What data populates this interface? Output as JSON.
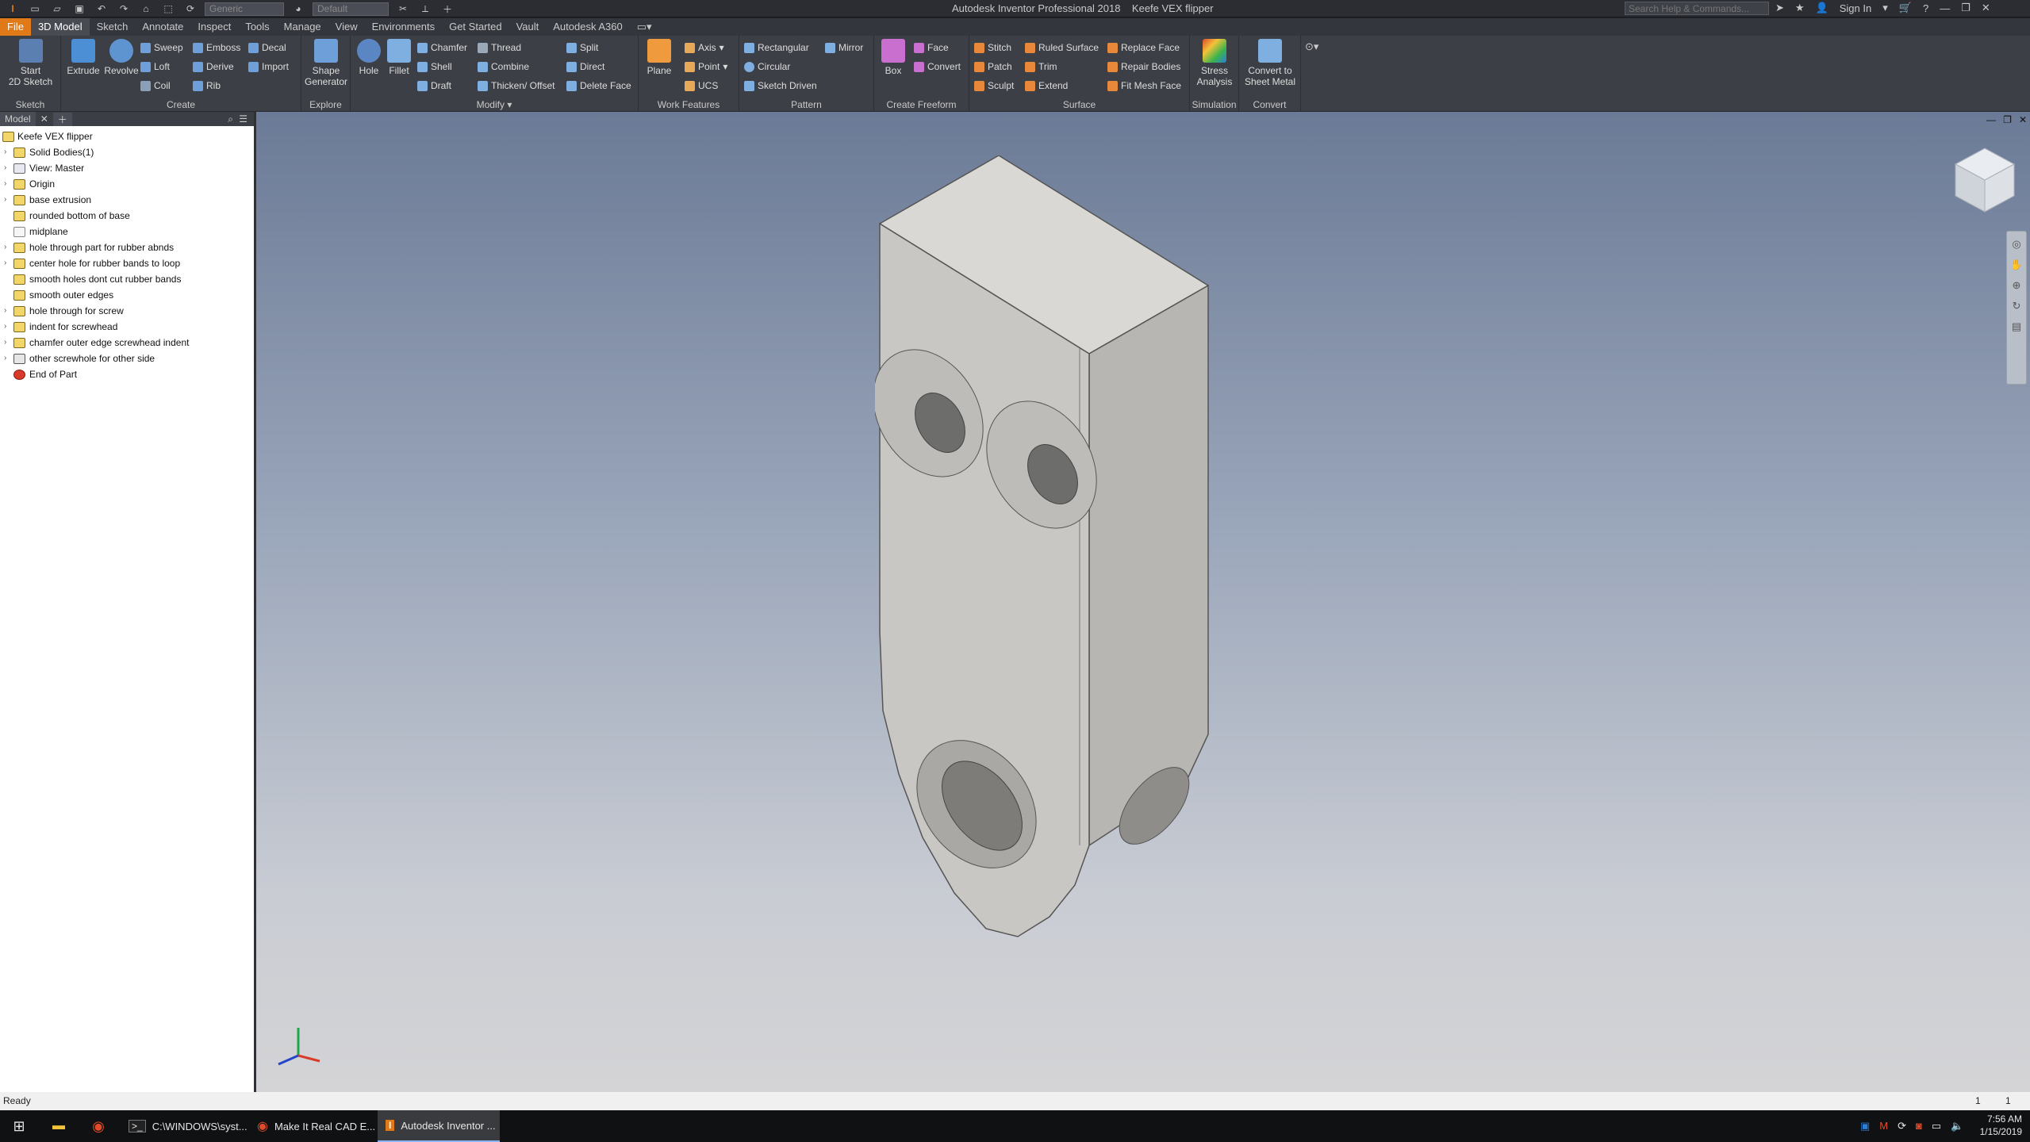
{
  "app": {
    "title": "Autodesk Inventor Professional 2018",
    "document": "Keefe VEX flipper"
  },
  "quick_access": {
    "material_combo": "Generic",
    "appearance_combo": "Default"
  },
  "search": {
    "placeholder": "Search Help & Commands..."
  },
  "account": {
    "sign_in": "Sign In"
  },
  "tabs": [
    "File",
    "3D Model",
    "Sketch",
    "Annotate",
    "Inspect",
    "Tools",
    "Manage",
    "View",
    "Environments",
    "Get Started",
    "Vault",
    "Autodesk A360"
  ],
  "ribbon": {
    "sketch": {
      "label": "Sketch",
      "start_sketch": "Start\n2D Sketch"
    },
    "create": {
      "label": "Create",
      "extrude": "Extrude",
      "revolve": "Revolve",
      "sweep": "Sweep",
      "loft": "Loft",
      "coil": "Coil",
      "emboss": "Emboss",
      "derive": "Derive",
      "rib": "Rib",
      "decal": "Decal",
      "import": "Import"
    },
    "explore": {
      "label": "Explore",
      "shape_generator": "Shape\nGenerator"
    },
    "modify": {
      "label": "Modify",
      "hole": "Hole",
      "fillet": "Fillet",
      "chamfer": "Chamfer",
      "shell": "Shell",
      "draft": "Draft",
      "thread": "Thread",
      "combine": "Combine",
      "thicken": "Thicken/ Offset",
      "split": "Split",
      "direct": "Direct",
      "delete_face": "Delete Face"
    },
    "work_features": {
      "label": "Work Features",
      "plane": "Plane",
      "axis": "Axis",
      "point": "Point",
      "ucs": "UCS"
    },
    "pattern": {
      "label": "Pattern",
      "rectangular": "Rectangular",
      "mirror": "Mirror",
      "circular": "Circular",
      "sketch_driven": "Sketch Driven"
    },
    "freeform": {
      "label": "Create Freeform",
      "box": "Box",
      "face": "Face",
      "convert": "Convert"
    },
    "surface": {
      "label": "Surface",
      "stitch": "Stitch",
      "patch": "Patch",
      "sculpt": "Sculpt",
      "ruled_surface": "Ruled Surface",
      "trim": "Trim",
      "extend": "Extend",
      "replace_face": "Replace Face",
      "repair_bodies": "Repair Bodies",
      "fit_mesh_face": "Fit Mesh Face"
    },
    "simulation": {
      "label": "Simulation",
      "stress": "Stress\nAnalysis"
    },
    "convert": {
      "label": "Convert",
      "sheet_metal": "Convert to\nSheet Metal"
    }
  },
  "browser": {
    "tab": "Model",
    "root": "Keefe VEX flipper",
    "nodes": [
      "Solid Bodies(1)",
      "View: Master",
      "Origin",
      "base extrusion",
      "rounded bottom of base",
      "midplane",
      "hole through part for rubber abnds",
      "center hole for rubber bands to loop",
      "smooth holes dont cut rubber bands",
      "smooth outer edges",
      "hole through for screw",
      "indent for screwhead",
      "chamfer outer edge screwhead indent",
      "other screwhole for other side",
      "End of Part"
    ]
  },
  "status": {
    "text": "Ready",
    "count1": "1",
    "count2": "1"
  },
  "taskbar": {
    "items": [
      "C:\\WINDOWS\\syst...",
      "Make It Real CAD E...",
      "Autodesk Inventor ..."
    ],
    "time": "7:56 AM",
    "date": "1/15/2019"
  },
  "colors": {
    "file_tab": "#e07918",
    "part_face": "#c8c7c3",
    "viewport_top": "#6b7a96"
  }
}
